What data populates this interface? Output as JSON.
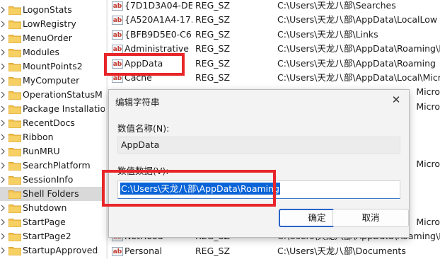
{
  "tree": {
    "items": [
      {
        "label": "LogonStats",
        "expand": true
      },
      {
        "label": "LowRegistry",
        "expand": true
      },
      {
        "label": "MenuOrder",
        "expand": true
      },
      {
        "label": "Modules",
        "expand": true
      },
      {
        "label": "MountPoints2",
        "expand": true
      },
      {
        "label": "MyComputer",
        "expand": true
      },
      {
        "label": "OperationStatusM",
        "expand": true
      },
      {
        "label": "Package Installatio",
        "expand": true
      },
      {
        "label": "RecentDocs",
        "expand": true
      },
      {
        "label": "Ribbon",
        "expand": true
      },
      {
        "label": "RunMRU",
        "expand": true
      },
      {
        "label": "SearchPlatform",
        "expand": true
      },
      {
        "label": "SessionInfo",
        "expand": true
      },
      {
        "label": "Shell Folders",
        "expand": false,
        "selected": true
      },
      {
        "label": "Shutdown",
        "expand": true
      },
      {
        "label": "StartPage",
        "expand": true
      },
      {
        "label": "StartPage2",
        "expand": true
      },
      {
        "label": "StartupApproved",
        "expand": true
      }
    ]
  },
  "values": {
    "rows": [
      {
        "name": "{7D1D3A04-DE...",
        "type": "REG_SZ",
        "data": "C:\\Users\\天龙八部\\Searches"
      },
      {
        "name": "{A520A1A4-17...",
        "type": "REG_SZ",
        "data": "C:\\Users\\天龙八部\\AppData\\LocalLow"
      },
      {
        "name": "{BFB9D5E0-C6...",
        "type": "REG_SZ",
        "data": "C:\\Users\\天龙八部\\Links"
      },
      {
        "name": "Administrative ...",
        "type": "REG_SZ",
        "data": "C:\\Users\\天龙八部\\AppData\\Roaming\\M"
      },
      {
        "name": "AppData",
        "type": "REG_SZ",
        "data": "C:\\Users\\天龙八部\\AppData\\Roaming"
      },
      {
        "name": "Cache",
        "type": "REG_SZ",
        "data": "C:\\Users\\天龙八部\\AppData\\Local\\Micro"
      },
      {
        "name": "",
        "type": "",
        "data": "Micro"
      },
      {
        "name": "",
        "type": "",
        "data": "Micro"
      },
      {
        "name": "",
        "type": "",
        "data": ""
      },
      {
        "name": "",
        "type": "",
        "data": ""
      },
      {
        "name": "",
        "type": "",
        "data": ""
      },
      {
        "name": "",
        "type": "",
        "data": "Micro"
      },
      {
        "name": "",
        "type": "",
        "data": ""
      },
      {
        "name": "",
        "type": "",
        "data": ""
      },
      {
        "name": "",
        "type": "",
        "data": ""
      },
      {
        "name": "",
        "type": "",
        "data": "Micro"
      },
      {
        "name": "NetHood",
        "type": "REG_SZ",
        "data": "C:\\Users\\天龙八部\\AppData\\Roaming\\M"
      },
      {
        "name": "Personal",
        "type": "REG_SZ",
        "data": "C:\\Users\\天龙八部\\Documents"
      }
    ]
  },
  "dialog": {
    "title": "编辑字符串",
    "close_glyph": "✕",
    "name_label": "数值名称(N):",
    "name_value": "AppData",
    "data_label": "数值数据(V):",
    "data_value": "C:\\Users\\天龙八部\\AppData\\Roaming",
    "ok_label": "确定",
    "cancel_label": "取消"
  },
  "icons": {
    "string_value_icon": "ab",
    "folder_icon": "folder-icon",
    "chevron_icon": "chevron-right-icon"
  },
  "colors": {
    "highlight": "#e8262a",
    "selection": "#0a64d7",
    "folder": "#f2c14e",
    "ok_border": "#2a64c9"
  }
}
